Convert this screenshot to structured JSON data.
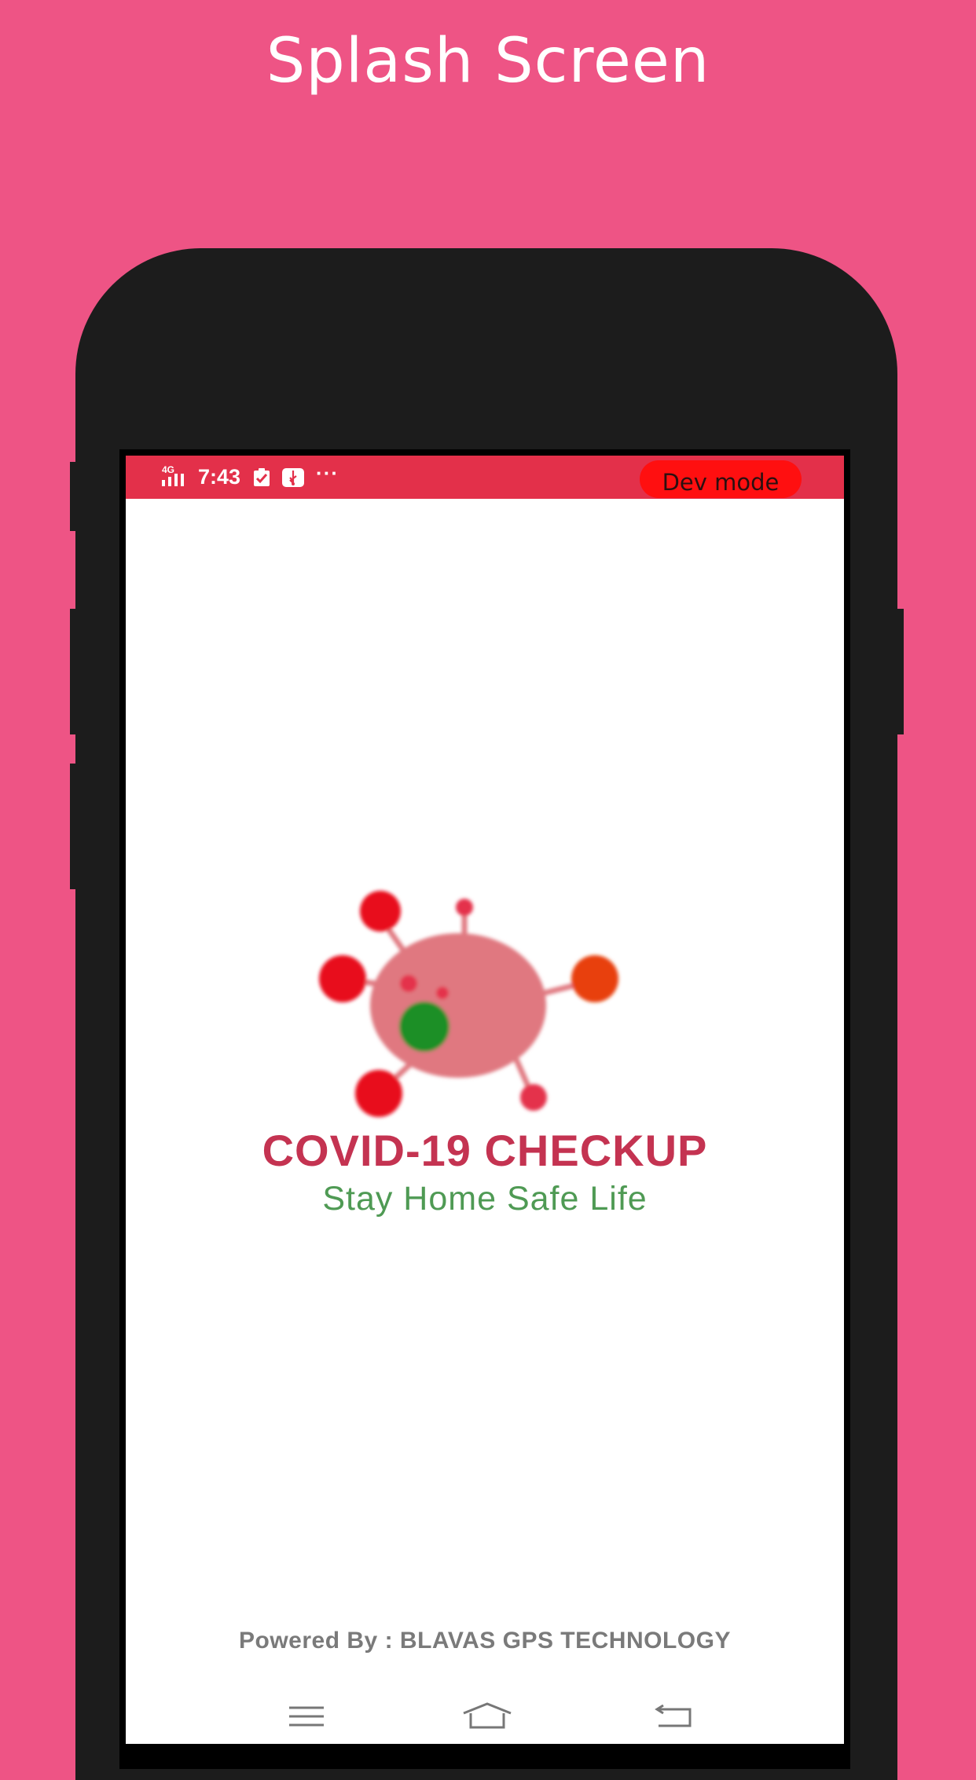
{
  "banner": {
    "title": "Splash Screen"
  },
  "status_bar": {
    "network": "4G",
    "time": "7:43",
    "more": "···",
    "dev_mode_label": "Dev mode"
  },
  "splash": {
    "app_title": "COVID-19 CHECKUP",
    "tagline": "Stay Home Safe Life",
    "powered_by": "Powered By : BLAVAS GPS TECHNOLOGY"
  },
  "nav": {
    "items": [
      "menu-icon",
      "home-icon",
      "back-icon"
    ]
  },
  "colors": {
    "background": "#ee5485",
    "status_bar": "#e3304a",
    "dev_pill": "#ff0f10",
    "title": "#c43351",
    "tagline": "#4f9a54",
    "virus_body": "#e07880",
    "virus_green": "#1e8f25"
  }
}
